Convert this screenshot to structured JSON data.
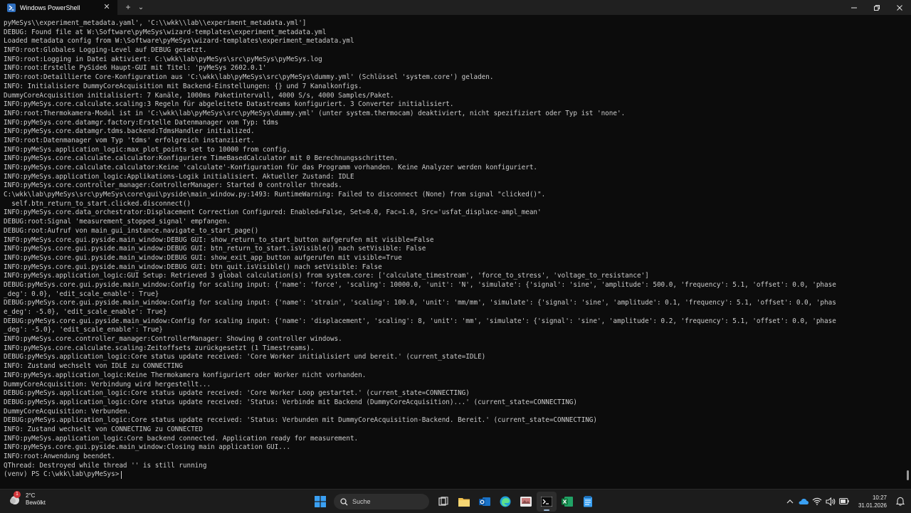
{
  "window": {
    "tab_title": "Windows PowerShell",
    "new_tab_symbol": "+",
    "dropdown_symbol": "⌄"
  },
  "colors": {
    "background": "#0c0c0c",
    "text": "#cccccc",
    "titlebar": "#202020",
    "taskbar": "#1c1c1c",
    "accent": "#0078d4"
  },
  "terminal": {
    "lines": [
      "pyMeSys\\\\experiment_metadata.yaml', 'C:\\\\wkk\\\\lab\\\\experiment_metadata.yml']",
      "DEBUG: Found file at W:\\Software\\pyMeSys\\wizard-templates\\experiment_metadata.yml",
      "Loaded metadata config from W:\\Software\\pyMeSys\\wizard-templates\\experiment_metadata.yml",
      "INFO:root:Globales Logging-Level auf DEBUG gesetzt.",
      "INFO:root:Logging in Datei aktiviert: C:\\wkk\\lab\\pyMeSys\\src\\pyMeSys\\pyMeSys.log",
      "INFO:root:Erstelle PySide6 Haupt-GUI mit Titel: 'pyMeSys 2602.0.1'",
      "INFO:root:Detaillierte Core-Konfiguration aus 'C:\\wkk\\lab\\pyMeSys\\src\\pyMeSys\\dummy.yml' (Schlüssel 'system.core') geladen.",
      "INFO: Initialisiere DummyCoreAcquisition mit Backend-Einstellungen: {} und 7 Kanalkonfigs.",
      "DummyCoreAcquisition initialisiert: 7 Kanäle, 1000ms Paketintervall, 4000 S/s, 4000 Samples/Paket.",
      "INFO:pyMeSys.core.calculate.scaling:3 Regeln für abgeleitete Datastreams konfiguriert. 3 Converter initialisiert.",
      "INFO:root:Thermokamera-Modul ist in 'C:\\wkk\\lab\\pyMeSys\\src\\pyMeSys\\dummy.yml' (unter system.thermocam) deaktiviert, nicht spezifiziert oder Typ ist 'none'.",
      "INFO:pyMeSys.core.datamgr.factory:Erstelle Datenmanager vom Typ: tdms",
      "INFO:pyMeSys.core.datamgr.tdms.backend:TdmsHandler initialized.",
      "INFO:root:Datenmanager vom Typ 'tdms' erfolgreich instanziiert.",
      "INFO:pyMeSys.application_logic:max_plot_points set to 10000 from config.",
      "INFO:pyMeSys.core.calculate.calculator:Konfiguriere TimeBasedCalculator mit 0 Berechnungsschritten.",
      "INFO:pyMeSys.core.calculate.calculator:Keine 'calculate'-Konfiguration für das Programm vorhanden. Keine Analyzer werden konfiguriert.",
      "INFO:pyMeSys.application_logic:Applikations-Logik initialisiert. Aktueller Zustand: IDLE",
      "INFO:pyMeSys.core.controller_manager:ControllerManager: Started 0 controller threads.",
      "C:\\wkk\\lab\\pyMeSys\\src\\pyMeSys\\core\\gui\\pyside\\main_window.py:1493: RuntimeWarning: Failed to disconnect (None) from signal \"clicked()\".",
      "  self.btn_return_to_start.clicked.disconnect()",
      "INFO:pyMeSys.core.data_orchestrator:Displacement Correction Configured: Enabled=False, Set=0.0, Fac=1.0, Src='usfat_displace-ampl_mean'",
      "DEBUG:root:Signal 'measurement_stopped_signal' empfangen.",
      "DEBUG:root:Aufruf von main_gui_instance.navigate_to_start_page()",
      "INFO:pyMeSys.core.gui.pyside.main_window:DEBUG GUI: show_return_to_start_button aufgerufen mit visible=False",
      "INFO:pyMeSys.core.gui.pyside.main_window:DEBUG GUI: btn_return_to_start.isVisible() nach setVisible: False",
      "INFO:pyMeSys.core.gui.pyside.main_window:DEBUG GUI: show_exit_app_button aufgerufen mit visible=True",
      "INFO:pyMeSys.core.gui.pyside.main_window:DEBUG GUI: btn_quit.isVisible() nach setVisible: False",
      "INFO:pyMeSys.application_logic:GUI Setup: Retrieved 3 global calculation(s) from system.core: ['calculate_timestream', 'force_to_stress', 'voltage_to_resistance']",
      "DEBUG:pyMeSys.core.gui.pyside.main_window:Config for scaling input: {'name': 'force', 'scaling': 10000.0, 'unit': 'N', 'simulate': {'signal': 'sine', 'amplitude': 500.0, 'frequency': 5.1, 'offset': 0.0, 'phase",
      "_deg': 0.0}, 'edit_scale_enable': True}",
      "DEBUG:pyMeSys.core.gui.pyside.main_window:Config for scaling input: {'name': 'strain', 'scaling': 100.0, 'unit': 'mm/mm', 'simulate': {'signal': 'sine', 'amplitude': 0.1, 'frequency': 5.1, 'offset': 0.0, 'phas",
      "e_deg': -5.0}, 'edit_scale_enable': True}",
      "DEBUG:pyMeSys.core.gui.pyside.main_window:Config for scaling input: {'name': 'displacement', 'scaling': 8, 'unit': 'mm', 'simulate': {'signal': 'sine', 'amplitude': 0.2, 'frequency': 5.1, 'offset': 0.0, 'phase",
      "_deg': -5.0}, 'edit_scale_enable': True}",
      "INFO:pyMeSys.core.controller_manager:ControllerManager: Showing 0 controller windows.",
      "INFO:pyMeSys.core.calculate.scaling:Zeitoffsets zurückgesetzt (1 Timestreams).",
      "DEBUG:pyMeSys.application_logic:Core status update received: 'Core Worker initialisiert und bereit.' (current_state=IDLE)",
      "INFO: Zustand wechselt von IDLE zu CONNECTING",
      "INFO:pyMeSys.application_logic:Keine Thermokamera konfiguriert oder Worker nicht vorhanden.",
      "DummyCoreAcquisition: Verbindung wird hergestellt...",
      "DEBUG:pyMeSys.application_logic:Core status update received: 'Core Worker Loop gestartet.' (current_state=CONNECTING)",
      "DEBUG:pyMeSys.application_logic:Core status update received: 'Status: Verbinde mit Backend (DummyCoreAcquisition)...' (current_state=CONNECTING)",
      "DummyCoreAcquisition: Verbunden.",
      "DEBUG:pyMeSys.application_logic:Core status update received: 'Status: Verbunden mit DummyCoreAcquisition-Backend. Bereit.' (current_state=CONNECTING)",
      "INFO: Zustand wechselt von CONNECTING zu CONNECTED",
      "INFO:pyMeSys.application_logic:Core backend connected. Application ready for measurement.",
      "INFO:pyMeSys.core.gui.pyside.main_window:Closing main application GUI...",
      "INFO:root:Anwendung beendet.",
      "QThread: Destroyed while thread '' is still running"
    ],
    "prompt": "(venv) PS C:\\wkk\\lab\\pyMeSys>"
  },
  "taskbar": {
    "weather_temp": "2°C",
    "weather_desc": "Bewölkt",
    "search_placeholder": "Suche",
    "time": "10:27",
    "date": "31.01.2026",
    "weather_badge": "1"
  }
}
